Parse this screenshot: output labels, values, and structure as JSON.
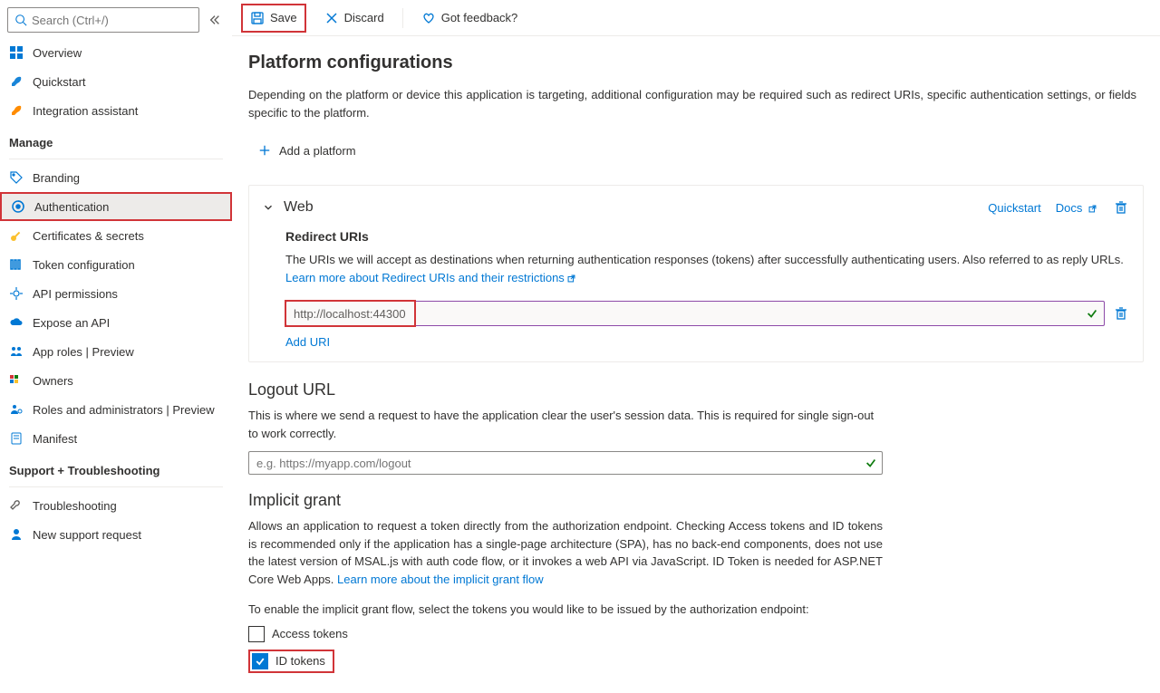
{
  "search": {
    "placeholder": "Search (Ctrl+/)"
  },
  "sidebar": {
    "items_top": [
      {
        "label": "Overview",
        "icon": "grid"
      },
      {
        "label": "Quickstart",
        "icon": "rocket"
      },
      {
        "label": "Integration assistant",
        "icon": "rocket-orange"
      }
    ],
    "group_manage": "Manage",
    "items_manage": [
      {
        "label": "Branding",
        "icon": "tag"
      },
      {
        "label": "Authentication",
        "icon": "auth",
        "selected": true
      },
      {
        "label": "Certificates & secrets",
        "icon": "key"
      },
      {
        "label": "Token configuration",
        "icon": "token"
      },
      {
        "label": "API permissions",
        "icon": "api"
      },
      {
        "label": "Expose an API",
        "icon": "cloud"
      },
      {
        "label": "App roles | Preview",
        "icon": "roles"
      },
      {
        "label": "Owners",
        "icon": "owners"
      },
      {
        "label": "Roles and administrators | Preview",
        "icon": "admin"
      },
      {
        "label": "Manifest",
        "icon": "manifest"
      }
    ],
    "group_support": "Support + Troubleshooting",
    "items_support": [
      {
        "label": "Troubleshooting",
        "icon": "wrench"
      },
      {
        "label": "New support request",
        "icon": "support"
      }
    ]
  },
  "toolbar": {
    "save": "Save",
    "discard": "Discard",
    "feedback": "Got feedback?"
  },
  "platform": {
    "title": "Platform configurations",
    "desc": "Depending on the platform or device this application is targeting, additional configuration may be required such as redirect URIs, specific authentication settings, or fields specific to the platform.",
    "add": "Add a platform"
  },
  "web": {
    "title": "Web",
    "quickstart": "Quickstart",
    "docs": "Docs",
    "redirect_title": "Redirect URIs",
    "redirect_desc": "The URIs we will accept as destinations when returning authentication responses (tokens) after successfully authenticating users. Also referred to as reply URLs. ",
    "redirect_link": "Learn more about Redirect URIs and their restrictions",
    "uri_value": "http://localhost:44300",
    "add_uri": "Add URI"
  },
  "logout": {
    "title": "Logout URL",
    "desc": "This is where we send a request to have the application clear the user's session data. This is required for single sign-out to work correctly.",
    "placeholder": "e.g. https://myapp.com/logout"
  },
  "implicit": {
    "title": "Implicit grant",
    "desc": "Allows an application to request a token directly from the authorization endpoint. Checking Access tokens and ID tokens is recommended only if the application has a single-page architecture (SPA), has no back-end components, does not use the latest version of MSAL.js with auth code flow, or it invokes a web API via JavaScript. ID Token is needed for ASP.NET Core Web Apps. ",
    "link": "Learn more about the implicit grant flow",
    "enable_text": "To enable the implicit grant flow, select the tokens you would like to be issued by the authorization endpoint:",
    "opt_access": "Access tokens",
    "opt_id": "ID tokens"
  }
}
